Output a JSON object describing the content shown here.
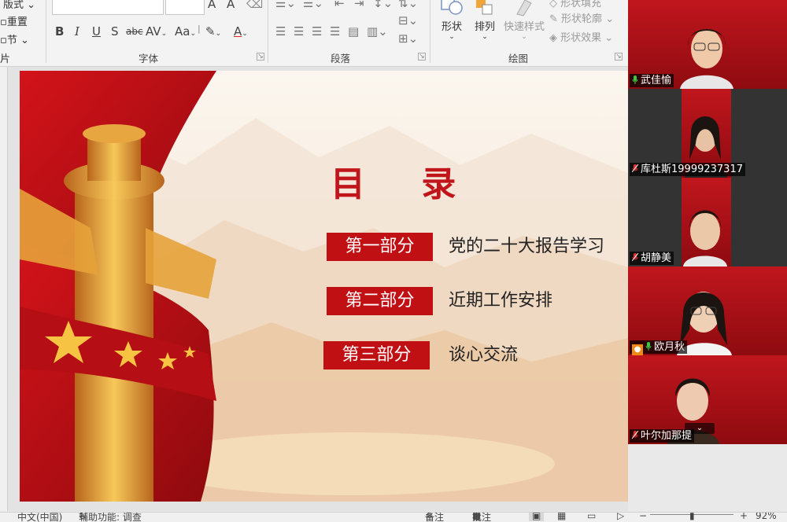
{
  "ribbon": {
    "slides_group": {
      "layout": "版式",
      "reset": "重置",
      "section": "节",
      "label_fragment": "片"
    },
    "font_group": {
      "label": "字体",
      "bold": "B",
      "italic": "I",
      "underline": "U",
      "shadow": "S",
      "strike": "abc",
      "spacing": "AV",
      "case": "Aa",
      "color": "A"
    },
    "paragraph_group": {
      "label": "段落"
    },
    "drawing_group": {
      "label": "绘图",
      "shapes": "形状",
      "arrange": "排列",
      "quick_styles": "快速样式",
      "fill": "形状填充",
      "outline": "形状轮廓",
      "effects": "形状效果"
    }
  },
  "slide": {
    "title": "目 录",
    "sections": [
      {
        "tag": "第一部分",
        "text": "党的二十大报告学习"
      },
      {
        "tag": "第二部分",
        "text": "近期工作安排"
      },
      {
        "tag": "第三部分",
        "text": "谈心交流"
      }
    ]
  },
  "participants": [
    {
      "name": "武佳愉",
      "mic": "on",
      "active": true
    },
    {
      "name": "库杜斯19999237317",
      "mic": "muted",
      "active": false
    },
    {
      "name": "胡静美",
      "mic": "muted",
      "active": false
    },
    {
      "name": "欧月秋",
      "mic": "on",
      "active": false,
      "host_icon": true
    },
    {
      "name": "叶尔加那提",
      "mic": "muted",
      "active": false
    }
  ],
  "statusbar": {
    "language": "中文(中国)",
    "accessibility": "辅助功能: 调查",
    "notes": "备注",
    "comments": "批注",
    "zoom": "92%"
  },
  "colors": {
    "accent_red": "#c11014",
    "title_red": "#c1151c",
    "mic_green": "#3ec63e",
    "mic_red": "#e23030"
  }
}
